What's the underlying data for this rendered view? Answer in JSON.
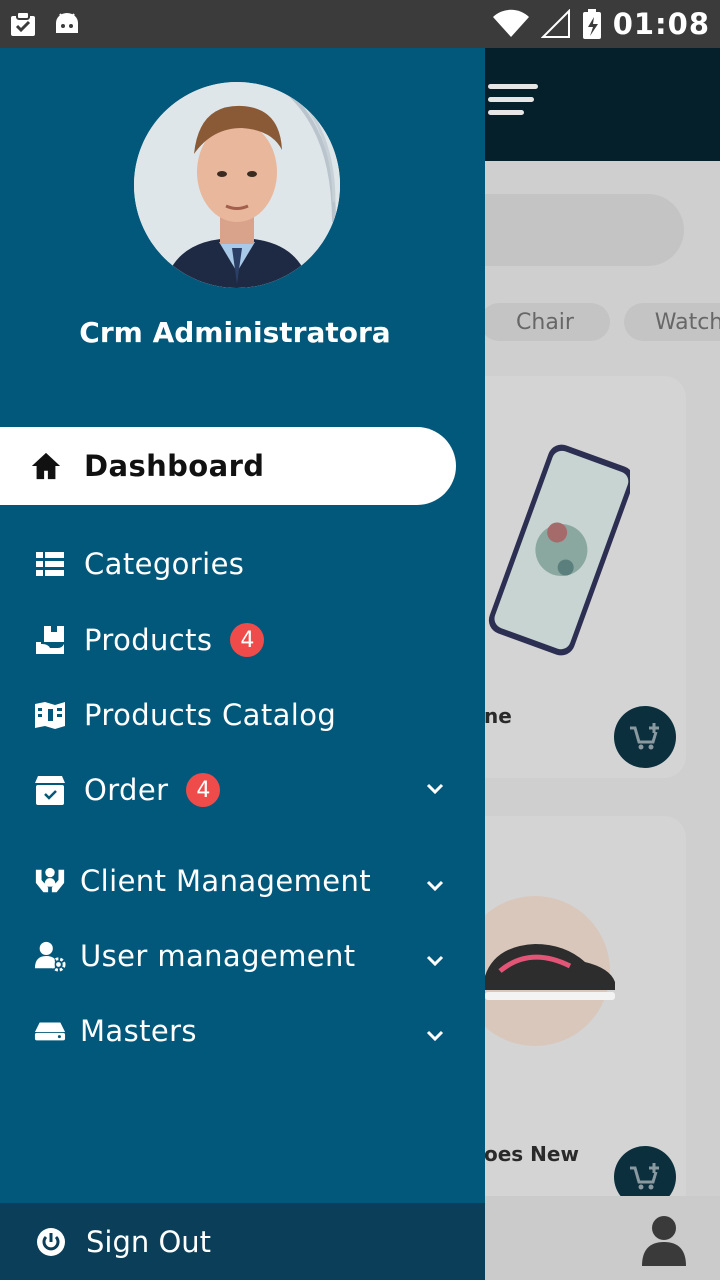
{
  "status_bar": {
    "time": "01:08",
    "left_icons": [
      "clipboard-check-icon",
      "android-icon"
    ],
    "right_icons": [
      "wifi-icon",
      "signal-icon",
      "battery-charging-icon"
    ]
  },
  "drawer": {
    "user_name": "Crm Administratora",
    "items": [
      {
        "label": "Dashboard",
        "icon": "home-icon",
        "active": true
      },
      {
        "label": "Categories",
        "icon": "list-icon"
      },
      {
        "label": "Products",
        "icon": "box-hand-icon",
        "badge": "4"
      },
      {
        "label": "Products  Catalog",
        "icon": "catalog-icon"
      },
      {
        "label": "Order",
        "icon": "order-box-icon",
        "badge": "4",
        "expandable": true
      },
      {
        "label": "Client Management",
        "icon": "client-hands-icon",
        "expandable": true
      },
      {
        "label": "User management",
        "icon": "user-gear-icon",
        "expandable": true
      },
      {
        "label": "Masters",
        "icon": "drive-icon",
        "expandable": true
      }
    ],
    "sign_out": {
      "label": "Sign Out",
      "icon": "power-icon"
    }
  },
  "background": {
    "chips": [
      "Chair",
      "Watch"
    ],
    "cards": [
      {
        "title": "ne"
      },
      {
        "title": "oes New"
      }
    ]
  },
  "colors": {
    "drawer": "#02587a",
    "signout_bar": "#0b3e59",
    "badge": "#ef4b4b",
    "header": "#06202b"
  }
}
